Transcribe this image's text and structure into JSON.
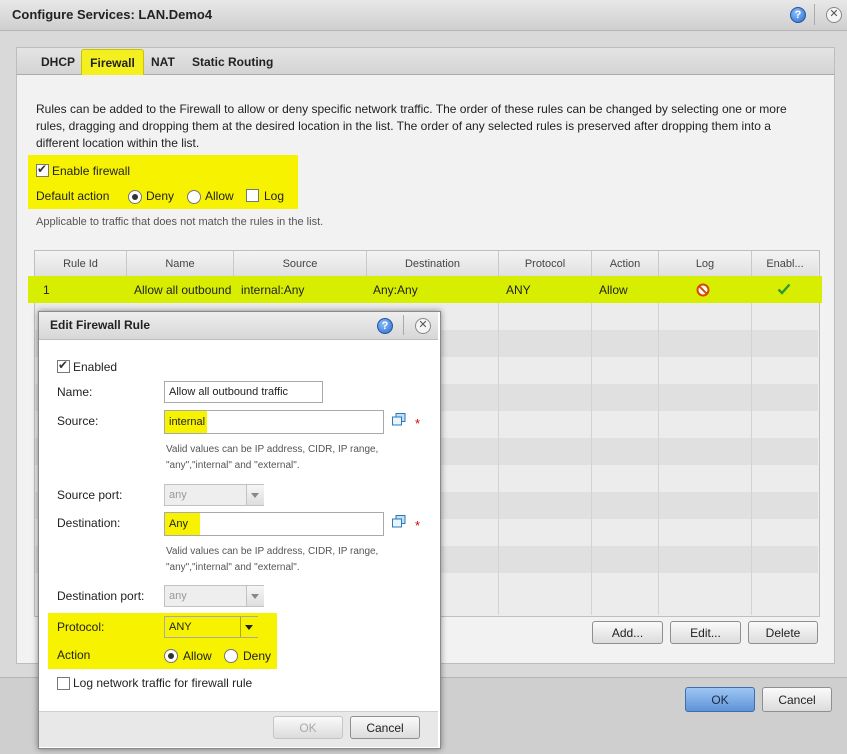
{
  "window": {
    "title": "Configure Services: LAN.Demo4",
    "help_glyph": "?",
    "close_glyph": "✕"
  },
  "tabs": [
    {
      "label": "DHCP"
    },
    {
      "label": "Firewall"
    },
    {
      "label": "NAT"
    },
    {
      "label": "Static Routing"
    }
  ],
  "active_tab": "Firewall",
  "description": "Rules can be added to the Firewall to allow or deny specific network traffic. The order of these rules can be changed by selecting one or more rules, dragging and dropping them at the desired location in the list. The order of any selected rules is preserved after dropping them into a different location within the list.",
  "firewall": {
    "enable_label": "Enable firewall",
    "enabled": true,
    "default_action_label": "Default action",
    "deny_label": "Deny",
    "allow_label": "Allow",
    "log_label": "Log",
    "default_action": "Deny",
    "log_checked": false,
    "applicable_note": "Applicable to traffic that does not match the rules in the list."
  },
  "rules_table": {
    "columns": [
      "Rule Id",
      "Name",
      "Source",
      "Destination",
      "Protocol",
      "Action",
      "Log",
      "Enabl..."
    ],
    "rows": [
      {
        "rule_id": "1",
        "name": "Allow all outbound traffic",
        "source": "internal:Any",
        "destination": "Any:Any",
        "protocol": "ANY",
        "action": "Allow",
        "log_icon": "no-log-icon",
        "enabled_icon": "checkmark-icon"
      }
    ]
  },
  "table_buttons": {
    "add": "Add...",
    "edit": "Edit...",
    "delete": "Delete"
  },
  "outer_buttons": {
    "ok": "OK",
    "cancel": "Cancel"
  },
  "edit_dialog": {
    "title": "Edit Firewall Rule",
    "enabled_label": "Enabled",
    "enabled": true,
    "name_label": "Name:",
    "name_value": "Allow all outbound traffic",
    "source_label": "Source:",
    "source_value": "internal",
    "source_hint_1": "Valid values can be IP address, CIDR, IP range,",
    "source_hint_2": "\"any\",\"internal\" and \"external\".",
    "source_port_label": "Source port:",
    "source_port_value": "any",
    "destination_label": "Destination:",
    "destination_value": "Any",
    "destination_hint_1": "Valid values can be IP address, CIDR, IP range,",
    "destination_hint_2": "\"any\",\"internal\" and \"external\".",
    "destination_port_label": "Destination port:",
    "destination_port_value": "any",
    "protocol_label": "Protocol:",
    "protocol_value": "ANY",
    "action_label": "Action",
    "allow_label": "Allow",
    "deny_label": "Deny",
    "action_value": "Allow",
    "log_label": "Log network traffic for firewall rule",
    "log_checked": false,
    "required_marker": "*",
    "ok_label": "OK",
    "cancel_label": "Cancel"
  },
  "colors": {
    "highlight": "#f7f200",
    "row_highlight": "#d8ee00",
    "ok_button": "#6fa0e0"
  }
}
